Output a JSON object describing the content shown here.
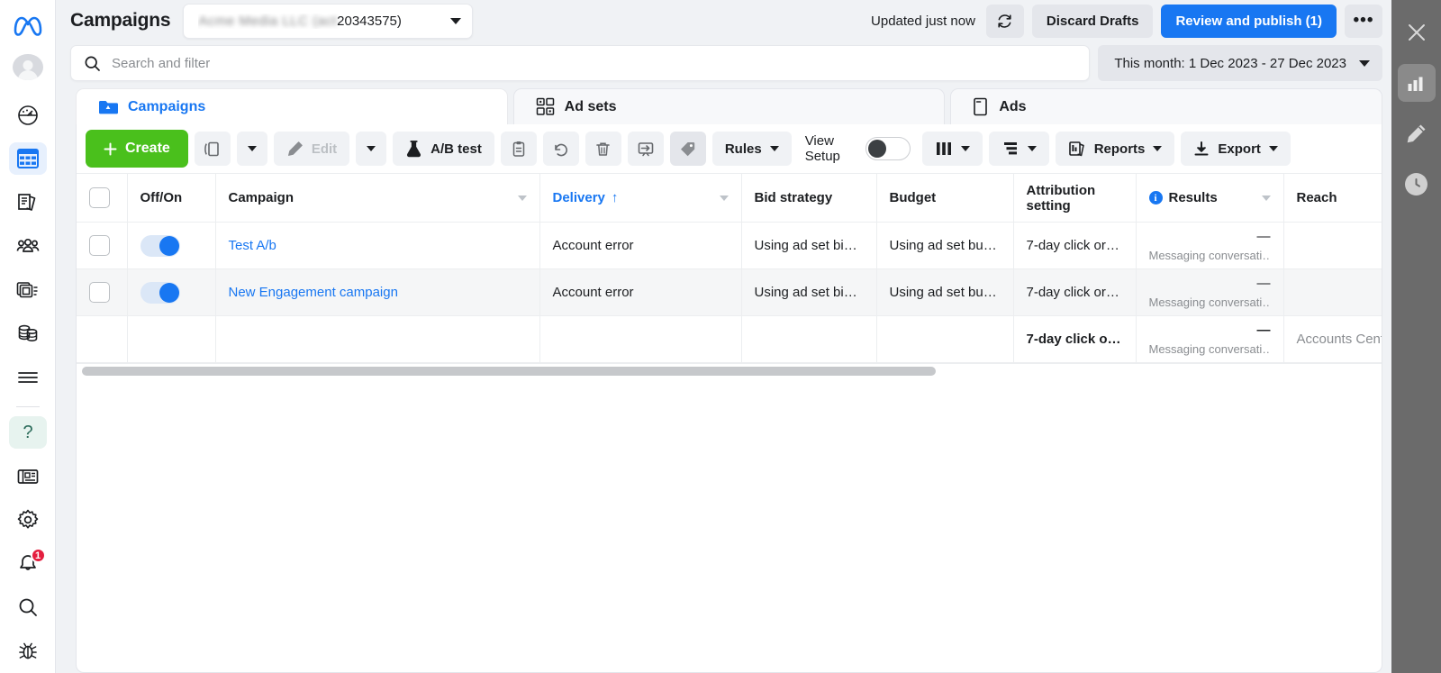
{
  "brand": {
    "logo": "meta-logo",
    "accent_blue": "#1877f2",
    "create_green": "#4ac01c",
    "error_red": "#e41e3f"
  },
  "topbar": {
    "title": "Campaigns",
    "account_blurred_prefix": "Ad account name hidden",
    "account_visible": "20343575)",
    "updated_label": "Updated just now",
    "refresh_icon": "refresh-icon",
    "discard_label": "Discard Drafts",
    "publish_label": "Review and publish (1)",
    "more_label": "•••"
  },
  "search": {
    "placeholder": "Search and filter",
    "value": "",
    "icon": "search-icon"
  },
  "daterange": {
    "label": "This month: 1 Dec 2023 - 27 Dec 2023"
  },
  "tabs": [
    {
      "label": "Campaigns",
      "icon": "campaigns-folder-icon",
      "active": true
    },
    {
      "label": "Ad sets",
      "icon": "ad-sets-grid-icon",
      "active": false
    },
    {
      "label": "Ads",
      "icon": "ads-page-icon",
      "active": false
    }
  ],
  "toolbar": {
    "create_label": "Create",
    "duplicate_icon": "duplicate-icon",
    "duplicate_caret": "chevron-down-icon",
    "edit_label": "Edit",
    "edit_icon": "pencil-icon",
    "edit_caret": "chevron-down-icon",
    "abtest_label": "A/B test",
    "abtest_icon": "flask-icon",
    "clipboard_icon": "clipboard-icon",
    "undo_icon": "undo-icon",
    "delete_icon": "trash-icon",
    "export_share_icon": "share-arrow-icon",
    "tag_icon": "tag-icon",
    "rules_label": "Rules",
    "view_setup_label_line1": "View",
    "view_setup_label_line2": "Setup",
    "view_setup_toggle": "off",
    "columns_icon": "columns-icon",
    "breakdown_icon": "breakdown-icon",
    "reports_label": "Reports",
    "reports_icon": "reports-icon",
    "export_label": "Export",
    "export_icon": "download-icon"
  },
  "table": {
    "columns": [
      {
        "key": "check",
        "label": ""
      },
      {
        "key": "offon",
        "label": "Off/On"
      },
      {
        "key": "campaign",
        "label": "Campaign",
        "has_caret": true
      },
      {
        "key": "delivery",
        "label": "Delivery",
        "sorted": true,
        "sort_arrow": "↑",
        "has_caret": true
      },
      {
        "key": "bid",
        "label": "Bid strategy"
      },
      {
        "key": "budget",
        "label": "Budget"
      },
      {
        "key": "attribution",
        "label": "Attribution setting"
      },
      {
        "key": "results",
        "label": "Results",
        "has_info": true,
        "has_caret": true
      },
      {
        "key": "reach",
        "label": "Reach"
      }
    ],
    "rows": [
      {
        "selected": false,
        "toggle": "on",
        "campaign": "Test A/b",
        "delivery": "Account error",
        "bid": "Using ad set bid …",
        "budget": "Using ad set bud…",
        "attribution": "7-day click or 1…",
        "results_value": "—",
        "results_sub": "Messaging conversati…",
        "reach": ""
      },
      {
        "selected": false,
        "toggle": "on",
        "campaign": "New Engagement campaign",
        "delivery": "Account error",
        "bid": "Using ad set bid …",
        "budget": "Using ad set bud…",
        "attribution": "7-day click or 1…",
        "results_value": "—",
        "results_sub": "Messaging conversati…",
        "reach": ""
      }
    ],
    "summary": {
      "campaign": "",
      "delivery": "",
      "bid": "",
      "budget": "",
      "attribution": "7-day click or …",
      "results_value": "—",
      "results_sub": "Messaging conversati…",
      "reach": "Accounts Centr"
    }
  },
  "left_rail": [
    {
      "name": "meta-logo",
      "label": "Meta"
    },
    {
      "name": "avatar",
      "label": "Profile"
    },
    {
      "name": "sidebar-item-overview",
      "label": "Overview"
    },
    {
      "name": "sidebar-item-campaigns",
      "label": "Campaigns",
      "active": true
    },
    {
      "name": "sidebar-item-library",
      "label": "Library"
    },
    {
      "name": "sidebar-item-audiences",
      "label": "Audiences"
    },
    {
      "name": "sidebar-item-creative",
      "label": "Creative"
    },
    {
      "name": "sidebar-item-billing",
      "label": "Billing"
    },
    {
      "name": "sidebar-item-menu",
      "label": "All tools"
    },
    {
      "name": "sidebar-item-help",
      "label": "Help",
      "badge": null
    },
    {
      "name": "sidebar-item-news",
      "label": "News"
    },
    {
      "name": "sidebar-item-settings",
      "label": "Settings"
    },
    {
      "name": "sidebar-item-notifications",
      "label": "Notifications",
      "badge": "1"
    },
    {
      "name": "sidebar-item-search",
      "label": "Search"
    },
    {
      "name": "sidebar-item-bug",
      "label": "Report bug"
    }
  ],
  "right_rail": [
    {
      "name": "close-icon",
      "label": "Close",
      "active": false
    },
    {
      "name": "bar-chart-icon",
      "label": "Charts",
      "active": true
    },
    {
      "name": "pencil-icon",
      "label": "Edit",
      "active": false
    },
    {
      "name": "clock-icon",
      "label": "Activity history",
      "active": false
    }
  ]
}
